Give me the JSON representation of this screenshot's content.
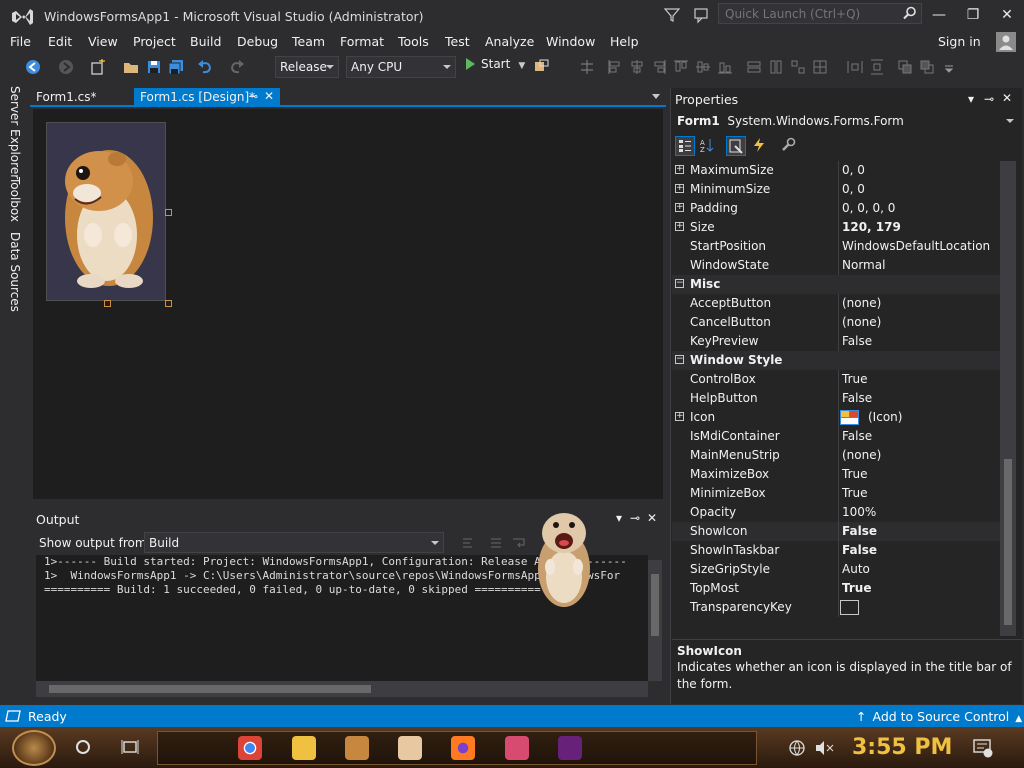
{
  "window": {
    "title": "WindowsFormsApp1 - Microsoft Visual Studio  (Administrator)",
    "quick_launch_placeholder": "Quick Launch (Ctrl+Q)",
    "minimize": "—",
    "restore": "❐",
    "close": "✕"
  },
  "menu": {
    "items": [
      "File",
      "Edit",
      "View",
      "Project",
      "Build",
      "Debug",
      "Team",
      "Format",
      "Tools",
      "Test",
      "Analyze",
      "Window",
      "Help"
    ],
    "sign_in": "Sign in"
  },
  "toolbar": {
    "configuration": "Release",
    "platform": "Any CPU",
    "start": "Start"
  },
  "left_strip": {
    "tabs": [
      "Server Explorer",
      "Toolbox",
      "Data Sources"
    ]
  },
  "documents": {
    "tabs": [
      {
        "label": "Form1.cs*"
      },
      {
        "label": "Form1.cs [Design]*"
      }
    ],
    "pin": "⊸",
    "close": "✕"
  },
  "output": {
    "title": "Output",
    "show_output_from_label": "Show output from:",
    "source": "Build",
    "lines": [
      "1>------ Build started: Project: WindowsFormsApp1, Configuration: Release Any CPU ------",
      "1>  WindowsFormsApp1 -> C:\\Users\\Administrator\\source\\repos\\WindowsFormsApp1\\WindowsFor",
      "========== Build: 1 succeeded, 0 failed, 0 up-to-date, 0 skipped =========="
    ],
    "controls": [
      "▾",
      "⊸",
      "✕"
    ]
  },
  "properties": {
    "title": "Properties",
    "controls": [
      "▾",
      "⊸",
      "✕"
    ],
    "object_name": "Form1",
    "object_type": "System.Windows.Forms.Form",
    "rows": [
      {
        "name": "MaximumSize",
        "value": "0, 0",
        "expand": "+",
        "bold": false
      },
      {
        "name": "MinimumSize",
        "value": "0, 0",
        "expand": "+",
        "bold": false
      },
      {
        "name": "Padding",
        "value": "0, 0, 0, 0",
        "expand": "+",
        "bold": false
      },
      {
        "name": "Size",
        "value": "120, 179",
        "expand": "+",
        "bold": true
      },
      {
        "name": "StartPosition",
        "value": "WindowsDefaultLocation",
        "expand": "",
        "bold": false
      },
      {
        "name": "WindowState",
        "value": "Normal",
        "expand": "",
        "bold": false
      },
      {
        "name": "Misc",
        "value": "",
        "expand": "−",
        "category": true
      },
      {
        "name": "AcceptButton",
        "value": "(none)",
        "expand": "",
        "bold": false
      },
      {
        "name": "CancelButton",
        "value": "(none)",
        "expand": "",
        "bold": false
      },
      {
        "name": "KeyPreview",
        "value": "False",
        "expand": "",
        "bold": false
      },
      {
        "name": "Window Style",
        "value": "",
        "expand": "−",
        "category": true
      },
      {
        "name": "ControlBox",
        "value": "True",
        "expand": "",
        "bold": false
      },
      {
        "name": "HelpButton",
        "value": "False",
        "expand": "",
        "bold": false
      },
      {
        "name": "Icon",
        "value": "(Icon)",
        "expand": "+",
        "bold": false,
        "swatch": "icon"
      },
      {
        "name": "IsMdiContainer",
        "value": "False",
        "expand": "",
        "bold": false
      },
      {
        "name": "MainMenuStrip",
        "value": "(none)",
        "expand": "",
        "bold": false
      },
      {
        "name": "MaximizeBox",
        "value": "True",
        "expand": "",
        "bold": false
      },
      {
        "name": "MinimizeBox",
        "value": "True",
        "expand": "",
        "bold": false
      },
      {
        "name": "Opacity",
        "value": "100%",
        "expand": "",
        "bold": false
      },
      {
        "name": "ShowIcon",
        "value": "False",
        "expand": "",
        "bold": true
      },
      {
        "name": "ShowInTaskbar",
        "value": "False",
        "expand": "",
        "bold": true
      },
      {
        "name": "SizeGripStyle",
        "value": "Auto",
        "expand": "",
        "bold": false
      },
      {
        "name": "TopMost",
        "value": "True",
        "expand": "",
        "bold": true
      },
      {
        "name": "TransparencyKey",
        "value": "",
        "expand": "",
        "bold": false,
        "swatch": "empty"
      }
    ],
    "description": {
      "title": "ShowIcon",
      "text": "Indicates whether an icon is displayed in the title bar of the form."
    }
  },
  "status": {
    "ready": "Ready",
    "source_control": "Add to Source Control"
  },
  "taskbar": {
    "clock": "3:55 PM"
  },
  "colors": {
    "accent": "#007acc",
    "background": "#2d2d30",
    "editor": "#1e1e1e",
    "clock": "#f0c040"
  }
}
